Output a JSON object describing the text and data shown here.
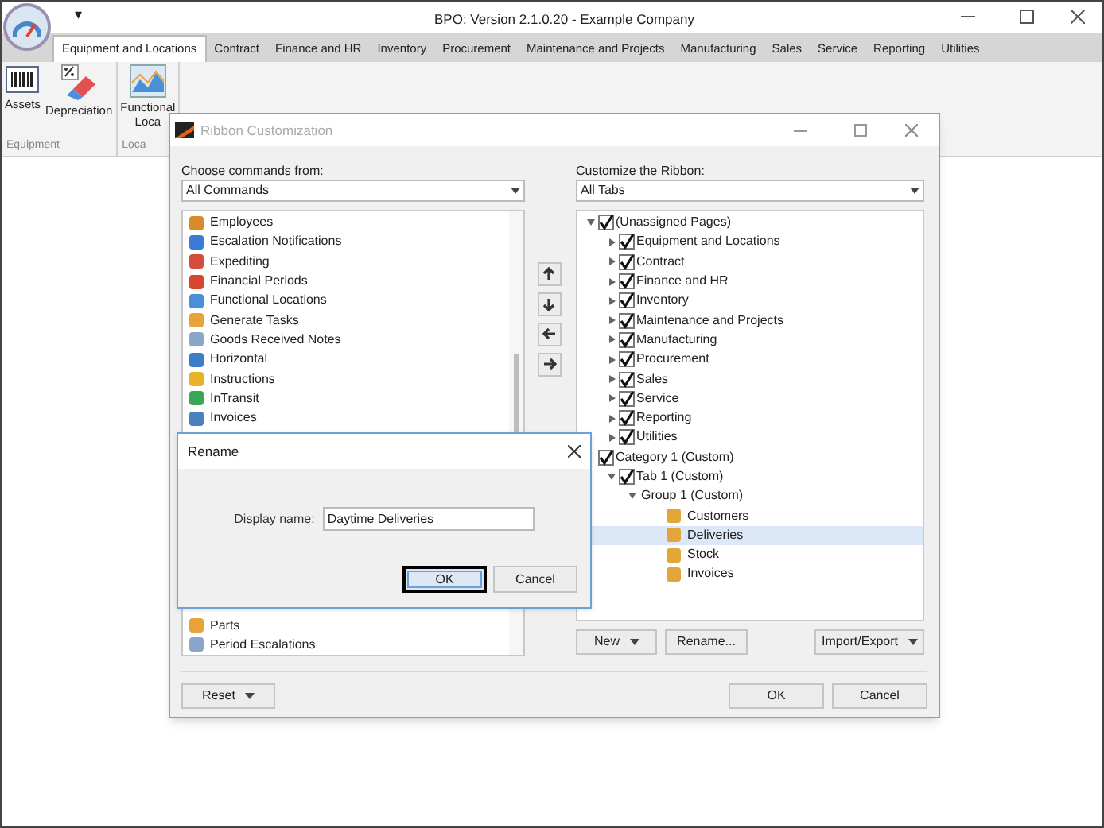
{
  "window": {
    "title": "BPO: Version 2.1.0.20 - Example Company",
    "quick_access": "▾"
  },
  "ribbon_tabs": [
    {
      "label": "Equipment and Locations",
      "selected": true
    },
    {
      "label": "Contract",
      "selected": false
    },
    {
      "label": "Finance and HR",
      "selected": false
    },
    {
      "label": "Inventory",
      "selected": false
    },
    {
      "label": "Procurement",
      "selected": false
    },
    {
      "label": "Maintenance and Projects",
      "selected": false
    },
    {
      "label": "Manufacturing",
      "selected": false
    },
    {
      "label": "Sales",
      "selected": false
    },
    {
      "label": "Service",
      "selected": false
    },
    {
      "label": "Reporting",
      "selected": false
    },
    {
      "label": "Utilities",
      "selected": false
    }
  ],
  "ribbon_groups": [
    {
      "label": "Equipment",
      "buttons": [
        {
          "label": "Assets",
          "kind": "barcode"
        },
        {
          "label": "Depreciation",
          "kind": "eraser"
        }
      ]
    },
    {
      "label": "Loca",
      "buttons": [
        {
          "label": "Functional Loca",
          "kind": "chart"
        }
      ]
    }
  ],
  "customization_dialog": {
    "title": "Ribbon Customization",
    "left": {
      "label": "Choose commands from:",
      "dropdown": "All Commands",
      "items_top": [
        "Employees",
        "Escalation Notifications",
        "Expediting",
        "Financial Periods",
        "Functional Locations",
        "Generate Tasks",
        "Goods Received Notes",
        "Horizontal",
        "Instructions",
        "InTransit",
        "Invoices"
      ],
      "items_bottom": [
        "Parts",
        "Period Escalations"
      ]
    },
    "right": {
      "label": "Customize the Ribbon:",
      "dropdown": "All Tabs",
      "tree": [
        {
          "label": "(Unassigned Pages)",
          "kind": "check",
          "checked": true,
          "expanded": true,
          "selected": false,
          "children": [
            {
              "label": "Equipment and Locations",
              "kind": "check",
              "checked": true,
              "expanded": false,
              "selected": false
            },
            {
              "label": "Contract",
              "kind": "check",
              "checked": true,
              "expanded": false,
              "selected": false
            },
            {
              "label": "Finance and HR",
              "kind": "check",
              "checked": true,
              "expanded": false,
              "selected": false
            },
            {
              "label": "Inventory",
              "kind": "check",
              "checked": true,
              "expanded": false,
              "selected": false
            },
            {
              "label": "Maintenance and Projects",
              "kind": "check",
              "checked": true,
              "expanded": false,
              "selected": false
            },
            {
              "label": "Manufacturing",
              "kind": "check",
              "checked": true,
              "expanded": false,
              "selected": false
            },
            {
              "label": "Procurement",
              "kind": "check",
              "checked": true,
              "expanded": false,
              "selected": false
            },
            {
              "label": "Sales",
              "kind": "check",
              "checked": true,
              "expanded": false,
              "selected": false
            },
            {
              "label": "Service",
              "kind": "check",
              "checked": true,
              "expanded": false,
              "selected": false
            },
            {
              "label": "Reporting",
              "kind": "check",
              "checked": true,
              "expanded": false,
              "selected": false
            },
            {
              "label": "Utilities",
              "kind": "check",
              "checked": true,
              "expanded": false,
              "selected": false
            }
          ]
        },
        {
          "label": "Category 1 (Custom)",
          "kind": "check",
          "checked": true,
          "selected": false,
          "children": [
            {
              "label": "Tab 1 (Custom)",
              "kind": "check",
              "checked": true,
              "expanded": true,
              "selected": false,
              "children": [
                {
                  "label": "Group 1 (Custom)",
                  "kind": "group",
                  "expanded": true,
                  "selected": false,
                  "children": [
                    {
                      "label": "Customers",
                      "kind": "command",
                      "selected": false
                    },
                    {
                      "label": "Deliveries",
                      "kind": "command",
                      "selected": true
                    },
                    {
                      "label": "Stock",
                      "kind": "command",
                      "selected": false
                    },
                    {
                      "label": "Invoices",
                      "kind": "command",
                      "selected": false
                    }
                  ]
                }
              ]
            }
          ]
        }
      ]
    },
    "tree_buttons": [
      {
        "label": "New",
        "dropdown": true
      },
      {
        "label": "Rename...",
        "dropdown": false
      },
      {
        "label": "Import/Export",
        "dropdown": true
      }
    ],
    "reset_button": {
      "label": "Reset",
      "dropdown": true
    },
    "buttons": [
      "OK",
      "Cancel"
    ]
  },
  "rename_dialog": {
    "title": "Rename",
    "field_label": "Display name:",
    "value": "Daytime Deliveries",
    "buttons": [
      {
        "label": "OK",
        "focused": true
      },
      {
        "label": "Cancel",
        "focused": false
      }
    ]
  }
}
